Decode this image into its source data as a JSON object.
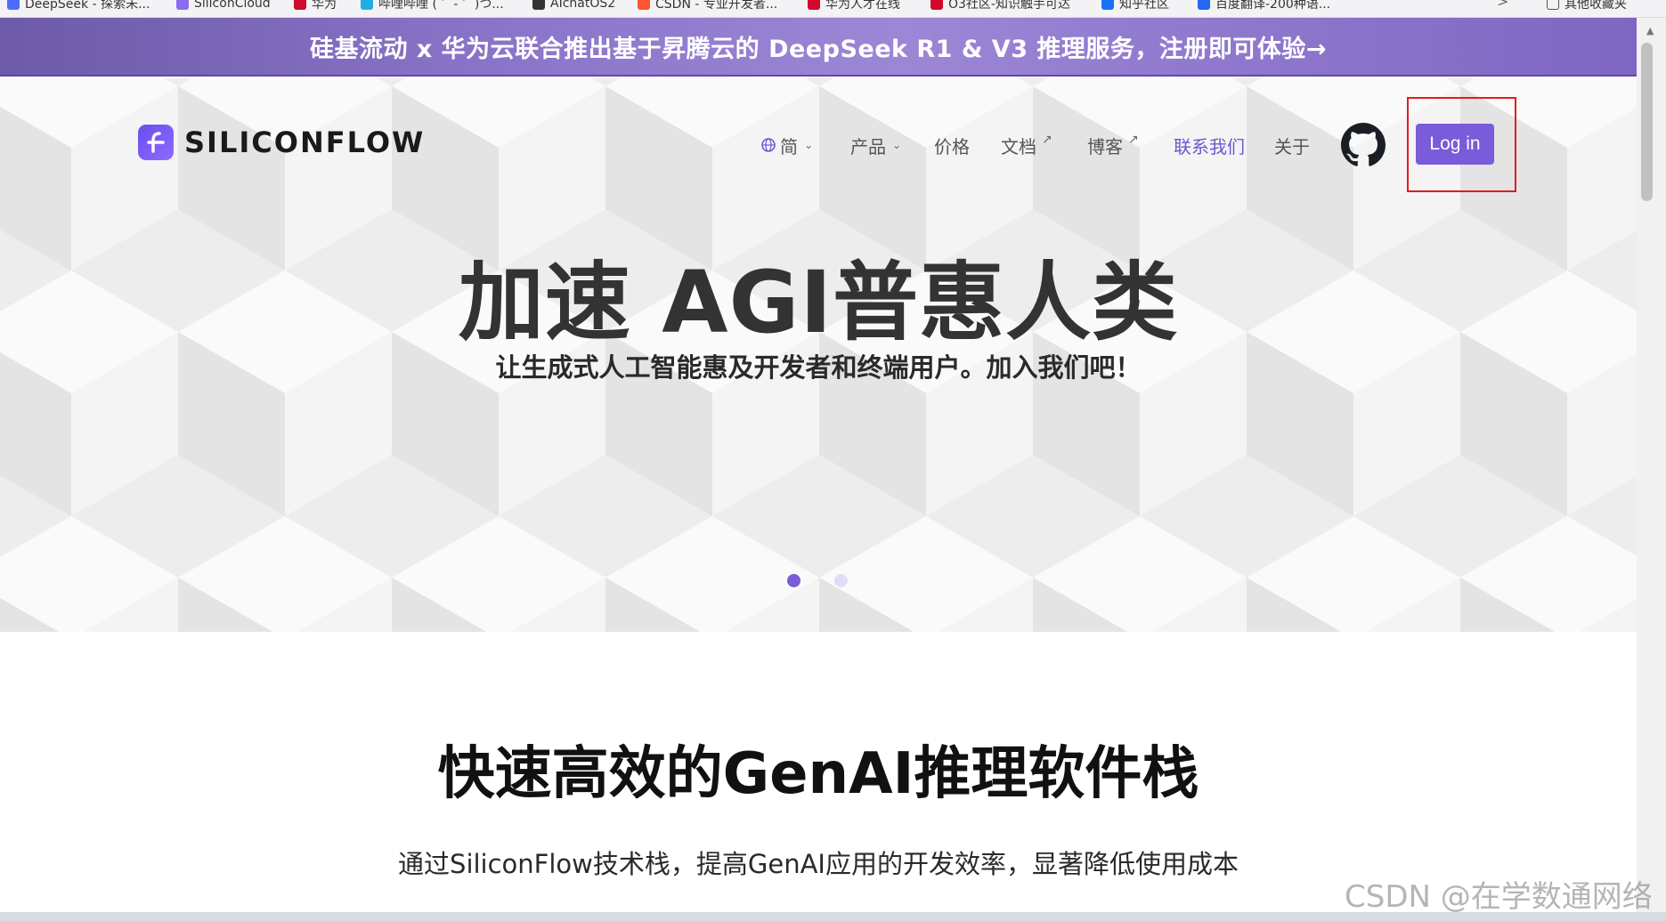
{
  "bookmarks": [
    {
      "label": "DeepSeek - 探索未...",
      "color": "#4d6bfe"
    },
    {
      "label": "SiliconCloud",
      "color": "#8a6cf0"
    },
    {
      "label": "华为",
      "color": "#cf0a2c"
    },
    {
      "label": "哔哩哔哩 ( ゜- ゜)つ...",
      "color": "#23ade5"
    },
    {
      "label": "AIchatOS2",
      "color": "#333333"
    },
    {
      "label": "CSDN - 专业开发者...",
      "color": "#fc5531"
    },
    {
      "label": "华为人才在线",
      "color": "#cf0a2c"
    },
    {
      "label": "O3社区-知识触手可达",
      "color": "#cf0a2c"
    },
    {
      "label": "知乎社区",
      "color": "#1772f6"
    },
    {
      "label": "百度翻译-200种语...",
      "color": "#2468f2"
    }
  ],
  "bookmarks_more": ">",
  "bookmarks_other": "其他收藏夹",
  "banner": {
    "text": "硅基流动 x 华为云联合推出基于昇腾云的 DeepSeek R1 & V3 推理服务，注册即可体验→"
  },
  "brand": {
    "name": "SILICONFLOW",
    "accent": "#7a5bd9"
  },
  "nav": {
    "lang": "简",
    "products": "产品",
    "pricing": "价格",
    "docs": "文档",
    "blog": "博客",
    "contact": "联系我们",
    "about": "关于",
    "login": "Log in"
  },
  "hero": {
    "title": "加速 AGI普惠人类",
    "subtitle": "让生成式人工智能惠及开发者和终端用户。加入我们吧！"
  },
  "carousel": {
    "active": 1,
    "total": 2
  },
  "section": {
    "title": "快速高效的GenAI推理软件栈",
    "description": "通过SiliconFlow技术栈，提高GenAI应用的开发效率，显著降低使用成本"
  },
  "watermark": "CSDN @在学数通网络"
}
